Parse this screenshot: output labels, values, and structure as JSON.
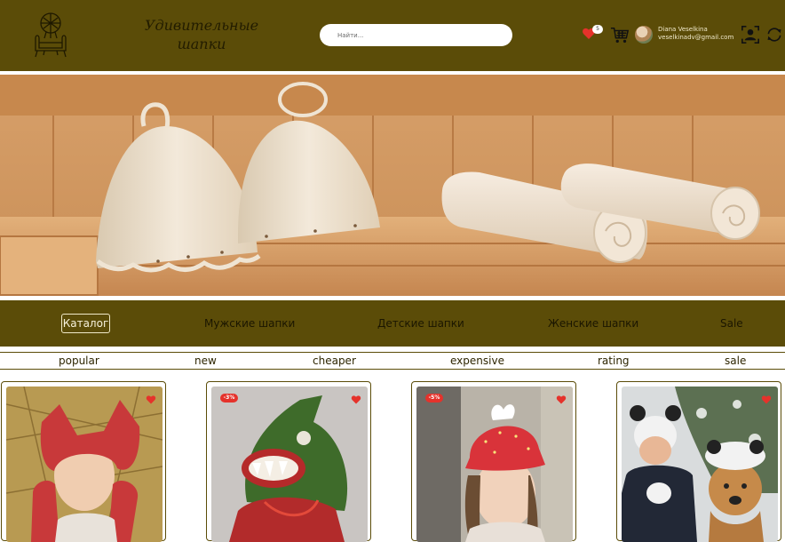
{
  "header": {
    "brand": "Удивительные шапки",
    "search_placeholder": "Найти...",
    "favorites_count": "5",
    "user_name": "Diana Veselkina",
    "user_email": "veselkinadv@gmail.com"
  },
  "hero": {
    "image": "banner-sauna-hats-towels"
  },
  "nav": {
    "items": [
      "Каталог",
      "Мужские шапки",
      "Детские шапки",
      "Женские шапки",
      "Sale"
    ]
  },
  "sort": {
    "items": [
      "popular",
      "new",
      "cheaper",
      "expensive",
      "rating",
      "sale"
    ]
  },
  "products": [
    {
      "image": "child-red-felt-hat",
      "discount": ""
    },
    {
      "image": "green-monster-felt-hat",
      "discount": "-3%"
    },
    {
      "image": "girl-strawberry-hat",
      "discount": "-5%"
    },
    {
      "image": "man-and-dog-panda-hats",
      "discount": ""
    }
  ],
  "colors": {
    "brand": "#5b4c08",
    "accent": "#e5322b"
  }
}
